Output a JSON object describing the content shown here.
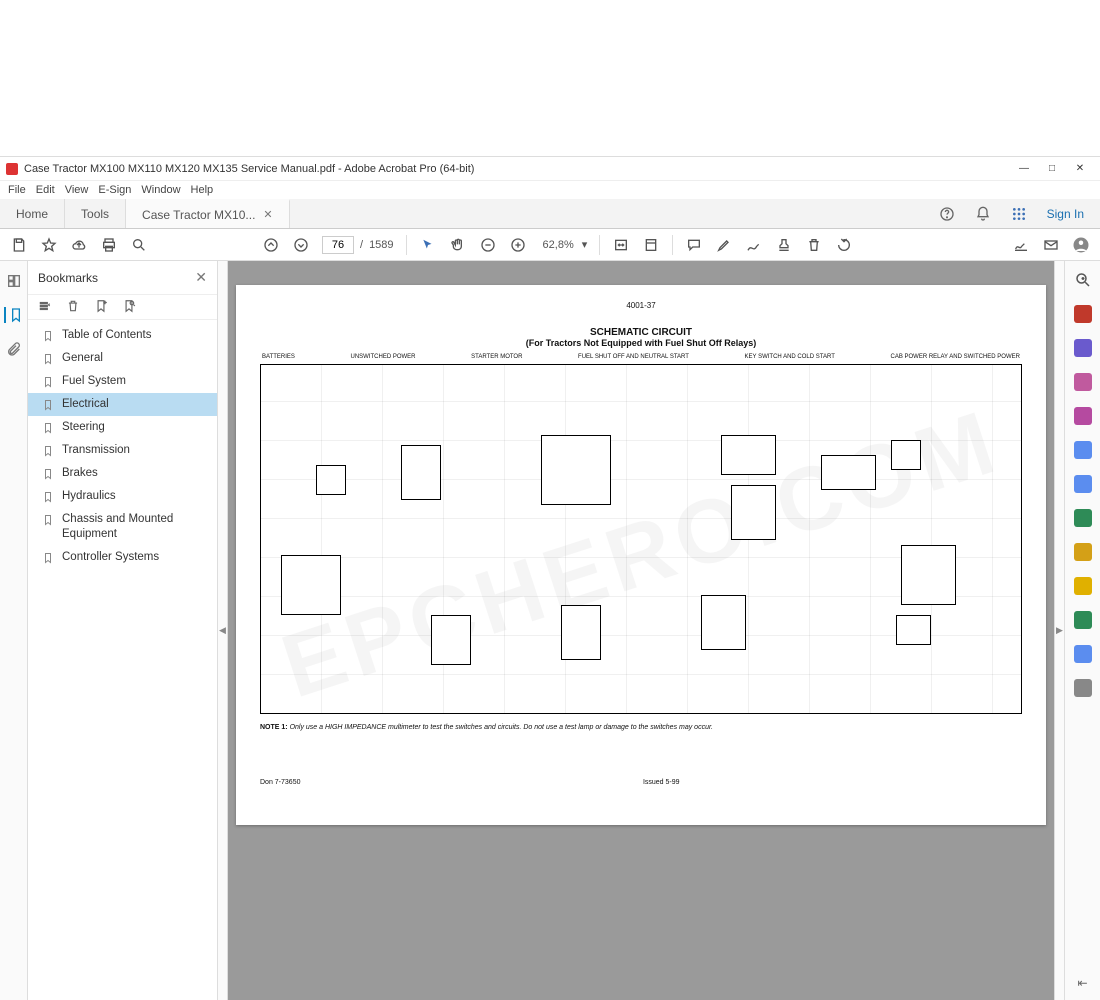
{
  "window": {
    "title": "Case Tractor MX100 MX110 MX120 MX135 Service Manual.pdf - Adobe Acrobat Pro (64-bit)"
  },
  "menu": {
    "items": [
      "File",
      "Edit",
      "View",
      "E-Sign",
      "Window",
      "Help"
    ]
  },
  "tabs": {
    "home": "Home",
    "tools": "Tools",
    "doc": "Case Tractor MX10...",
    "signin": "Sign In"
  },
  "toolbar": {
    "page_current": "76",
    "page_total": "1589",
    "page_sep": "/",
    "zoom": "62,8%"
  },
  "sidebar": {
    "title": "Bookmarks",
    "items": [
      {
        "label": "Table of Contents"
      },
      {
        "label": "General"
      },
      {
        "label": "Fuel System"
      },
      {
        "label": "Electrical",
        "active": true
      },
      {
        "label": "Steering"
      },
      {
        "label": "Transmission"
      },
      {
        "label": "Brakes"
      },
      {
        "label": "Hydraulics"
      },
      {
        "label": "Chassis and Mounted Equipment"
      },
      {
        "label": "Controller Systems"
      }
    ]
  },
  "document": {
    "page_id": "4001-37",
    "title": "SCHEMATIC CIRCUIT",
    "subtitle": "(For Tractors Not Equipped with Fuel Shut Off Relays)",
    "col_labels": [
      "BATTERIES",
      "UNSWITCHED POWER",
      "STARTER MOTOR",
      "FUEL SHUT OFF AND NEUTRAL START",
      "KEY SWITCH AND COLD START",
      "CAB POWER RELAY AND SWITCHED POWER"
    ],
    "note_label": "NOTE 1:",
    "note_text": "Only use a HIGH IMPEDANCE multimeter to test the switches and circuits. Do not use a test lamp or damage to the switches may occur.",
    "footer_left": "Don 7-73650",
    "footer_center": "Issued 5-99",
    "watermark": "EPCHERO.COM"
  },
  "right_tools_colors": [
    "#6aa6d8",
    "#c0392b",
    "#6a5acd",
    "#c05a9e",
    "#b54aa0",
    "#5b8def",
    "#2e8b57",
    "#2e8b57",
    "#d4a017",
    "#e0b000",
    "#2e8b57",
    "#5b8def",
    "#888"
  ]
}
